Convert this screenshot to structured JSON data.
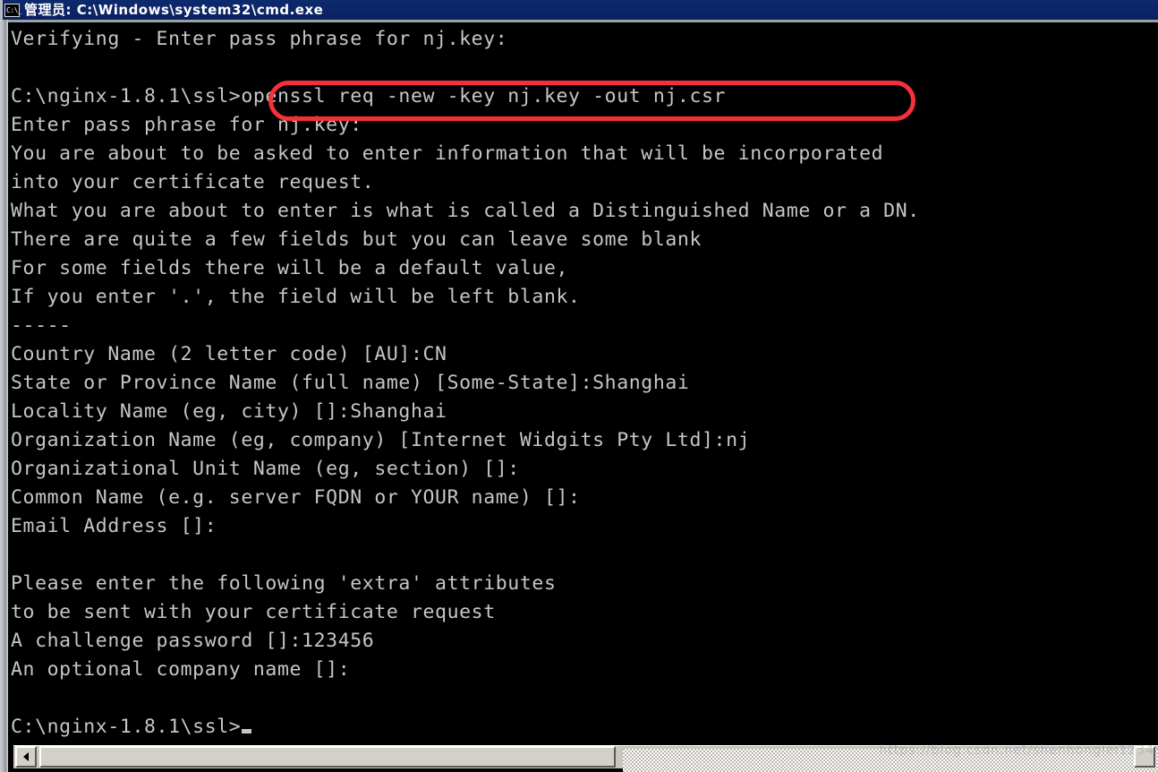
{
  "window": {
    "title": "管理员: C:\\Windows\\system32\\cmd.exe",
    "icon_name": "cmd-icon",
    "icon_glyph": "C:\\_",
    "titlebar_color": "#0b2566",
    "console_bg": "#000000",
    "console_fg": "#c6c6c6"
  },
  "console": {
    "lines": [
      "Verifying - Enter pass phrase for nj.key:",
      "",
      "C:\\nginx-1.8.1\\ssl>openssl req -new -key nj.key -out nj.csr",
      "Enter pass phrase for nj.key:",
      "You are about to be asked to enter information that will be incorporated",
      "into your certificate request.",
      "What you are about to enter is what is called a Distinguished Name or a DN.",
      "There are quite a few fields but you can leave some blank",
      "For some fields there will be a default value,",
      "If you enter '.', the field will be left blank.",
      "-----",
      "Country Name (2 letter code) [AU]:CN",
      "State or Province Name (full name) [Some-State]:Shanghai",
      "Locality Name (eg, city) []:Shanghai",
      "Organization Name (eg, company) [Internet Widgits Pty Ltd]:nj",
      "Organizational Unit Name (eg, section) []:",
      "Common Name (e.g. server FQDN or YOUR name) []:",
      "Email Address []:",
      "",
      "Please enter the following 'extra' attributes",
      "to be sent with your certificate request",
      "A challenge password []:123456",
      "An optional company name []:",
      "",
      "C:\\nginx-1.8.1\\ssl>"
    ],
    "prompt_path": "C:\\nginx-1.8.1\\ssl>",
    "highlighted_command": "openssl req -new -key nj.key -out nj.csr",
    "highlight_color": "#f6303a"
  },
  "scrollbar": {
    "left_arrow": "◄",
    "right_arrow": "►",
    "orientation": "horizontal"
  },
  "watermark": {
    "text": "https://blog.csdn.net/shenhonglei1234"
  }
}
